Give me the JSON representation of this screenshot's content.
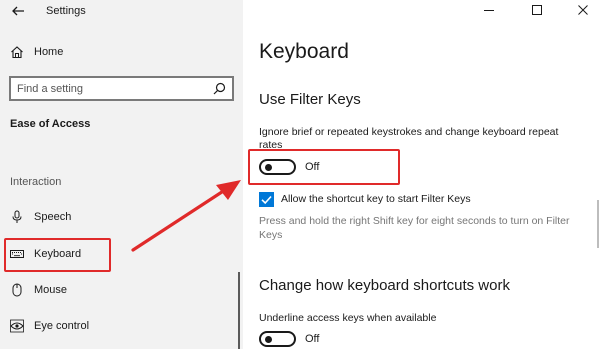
{
  "window": {
    "title": "Settings",
    "controls": {
      "minimize": "minimize-icon",
      "maximize": "maximize-icon",
      "close": "close-icon"
    }
  },
  "sidebar": {
    "home_label": "Home",
    "search_placeholder": "Find a setting",
    "section_heading": "Ease of Access",
    "group_label": "Interaction",
    "items": [
      {
        "label": "Speech",
        "icon": "microphone-icon"
      },
      {
        "label": "Keyboard",
        "icon": "keyboard-icon",
        "selected": true
      },
      {
        "label": "Mouse",
        "icon": "mouse-icon"
      },
      {
        "label": "Eye control",
        "icon": "eye-control-icon"
      }
    ]
  },
  "main": {
    "title": "Keyboard",
    "filter_keys": {
      "heading": "Use Filter Keys",
      "description": "Ignore brief or repeated keystrokes and change keyboard repeat rates",
      "toggle_state": "Off",
      "shortcut_checkbox_label": "Allow the shortcut key to start Filter Keys",
      "shortcut_checked": true,
      "hint": "Press and hold the right Shift key for eight seconds to turn on Filter Keys"
    },
    "shortcuts": {
      "heading": "Change how keyboard shortcuts work",
      "underline_label": "Underline access keys when available",
      "toggle_state": "Off"
    }
  },
  "colors": {
    "highlight": "#e02a2a",
    "accent": "#0078d7",
    "sidebar_bg": "#f2f2f2"
  }
}
